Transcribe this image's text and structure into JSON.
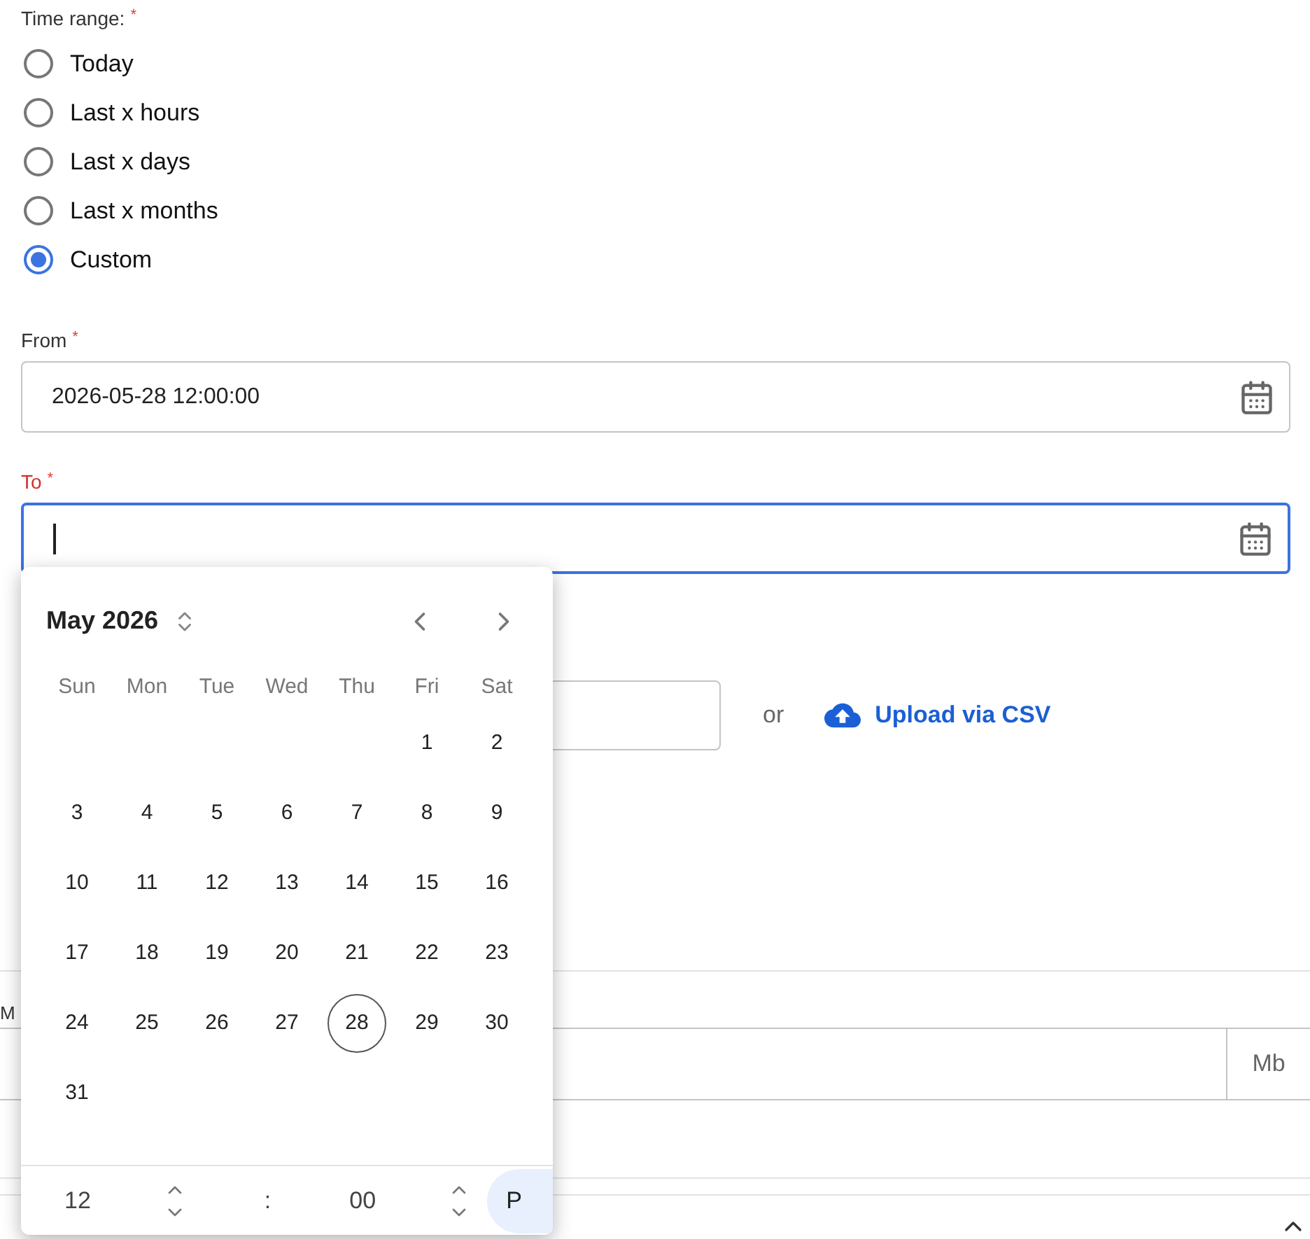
{
  "time_range": {
    "label": "Time range:",
    "required_mark": "*",
    "options": [
      {
        "label": "Today",
        "selected": false
      },
      {
        "label": "Last x hours",
        "selected": false
      },
      {
        "label": "Last x days",
        "selected": false
      },
      {
        "label": "Last x months",
        "selected": false
      },
      {
        "label": "Custom",
        "selected": true
      }
    ]
  },
  "from": {
    "label": "From",
    "required_mark": "*",
    "value": "2026-05-28 12:00:00",
    "focused": false
  },
  "to": {
    "label": "To",
    "required_mark": "*",
    "focused": true
  },
  "upload_row": {
    "separator": "or",
    "link": "Upload via CSV"
  },
  "size_field": {
    "label": "M",
    "suffix": "Mb"
  },
  "calendar": {
    "month": "May 2026",
    "weekdays": [
      "Sun",
      "Mon",
      "Tue",
      "Wed",
      "Thu",
      "Fri",
      "Sat"
    ],
    "weeks": [
      [
        {
          "label": "1",
          "selected": false
        },
        {
          "label": "2",
          "selected": false
        }
      ],
      [
        {
          "label": "3",
          "selected": false
        },
        {
          "label": "4",
          "selected": false
        },
        {
          "label": "5",
          "selected": false
        },
        {
          "label": "6",
          "selected": false
        },
        {
          "label": "7",
          "selected": false
        },
        {
          "label": "8",
          "selected": false
        },
        {
          "label": "9",
          "selected": false
        }
      ],
      [
        {
          "label": "10",
          "selected": false
        },
        {
          "label": "11",
          "selected": false
        },
        {
          "label": "12",
          "selected": false
        },
        {
          "label": "13",
          "selected": false
        },
        {
          "label": "14",
          "selected": false
        },
        {
          "label": "15",
          "selected": false
        },
        {
          "label": "16",
          "selected": false
        }
      ],
      [
        {
          "label": "17",
          "selected": false
        },
        {
          "label": "18",
          "selected": false
        },
        {
          "label": "19",
          "selected": false
        },
        {
          "label": "20",
          "selected": false
        },
        {
          "label": "21",
          "selected": false
        },
        {
          "label": "22",
          "selected": false
        },
        {
          "label": "23",
          "selected": false
        }
      ],
      [
        {
          "label": "24",
          "selected": false
        },
        {
          "label": "25",
          "selected": false
        },
        {
          "label": "26",
          "selected": false
        },
        {
          "label": "27",
          "selected": false
        },
        {
          "label": "28",
          "selected": true
        },
        {
          "label": "29",
          "selected": false
        },
        {
          "label": "30",
          "selected": false
        }
      ],
      [
        {
          "label": "31",
          "selected": false
        }
      ]
    ],
    "time": {
      "hour": "12",
      "separator": ":",
      "minute": "00",
      "period": "P"
    }
  }
}
